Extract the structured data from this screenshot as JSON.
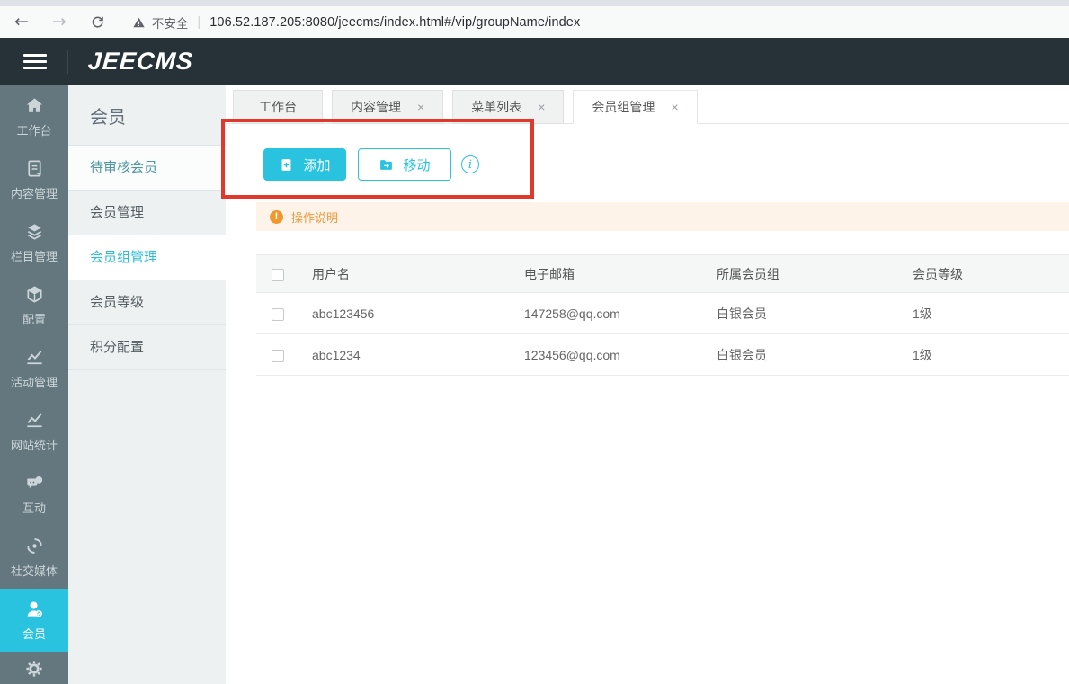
{
  "browser": {
    "security_label": "不安全",
    "url": "106.52.187.205:8080/jeecms/index.html#/vip/groupName/index",
    "icons": {
      "back": "←",
      "forward": "→",
      "separator": "|"
    }
  },
  "header": {
    "logo": "JEECMS"
  },
  "nav_rail": {
    "items": [
      {
        "label": "工作台",
        "icon": "home",
        "active": false
      },
      {
        "label": "内容管理",
        "icon": "document",
        "active": false
      },
      {
        "label": "栏目管理",
        "icon": "layers",
        "active": false
      },
      {
        "label": "配置",
        "icon": "cube",
        "active": false
      },
      {
        "label": "活动管理",
        "icon": "trend-chart",
        "active": false
      },
      {
        "label": "网站统计",
        "icon": "trend-chart",
        "active": false
      },
      {
        "label": "互动",
        "icon": "chat-bubbles",
        "active": false
      },
      {
        "label": "社交媒体",
        "icon": "orbit",
        "active": false
      },
      {
        "label": "会员",
        "icon": "member-check",
        "active": true
      }
    ],
    "footer_icon": "gear"
  },
  "submenu": {
    "title": "会员",
    "items": [
      {
        "label": "待审核会员",
        "state": "hovered"
      },
      {
        "label": "会员管理",
        "state": "normal"
      },
      {
        "label": "会员组管理",
        "state": "active"
      },
      {
        "label": "会员等级",
        "state": "normal"
      },
      {
        "label": "积分配置",
        "state": "normal"
      }
    ]
  },
  "tabs": {
    "close_glyph": "×",
    "items": [
      {
        "label": "工作台",
        "closable": false,
        "active": false
      },
      {
        "label": "内容管理",
        "closable": true,
        "active": false
      },
      {
        "label": "菜单列表",
        "closable": true,
        "active": false
      },
      {
        "label": "会员组管理",
        "closable": true,
        "active": true
      }
    ]
  },
  "toolbar": {
    "add_label": "添加",
    "move_label": "移动",
    "info_glyph": "i"
  },
  "notice": {
    "icon_glyph": "!",
    "text": "操作说明"
  },
  "table": {
    "headers": [
      "用户名",
      "电子邮箱",
      "所属会员组",
      "会员等级"
    ],
    "rows": [
      {
        "username": "abc123456",
        "email": "147258@qq.com",
        "group": "白银会员",
        "level": "1级"
      },
      {
        "username": "abc1234",
        "email": "123456@qq.com",
        "group": "白银会员",
        "level": "1级"
      }
    ]
  },
  "colors": {
    "accent": "#29c3e0",
    "annotation": "#e0392b",
    "warning": "#f0993e",
    "rail_bg": "#64777f",
    "appbar_bg": "#263238"
  }
}
